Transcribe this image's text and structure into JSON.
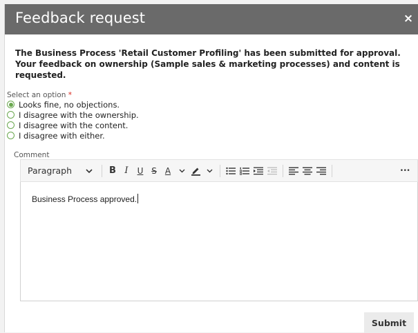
{
  "dialog": {
    "title": "Feedback request",
    "close_glyph": "×",
    "message": "The Business Process 'Retail Customer Profiling' has been submitted for approval. Your feedback on ownership (Sample sales & marketing processes) and content is requested."
  },
  "form": {
    "select_label": "Select an option",
    "required_mark": "*",
    "options": [
      {
        "label": "Looks fine, no objections.",
        "checked": true
      },
      {
        "label": "I disagree with the ownership.",
        "checked": false
      },
      {
        "label": "I disagree with the content.",
        "checked": false
      },
      {
        "label": "I disagree with either.",
        "checked": false
      }
    ],
    "comment_label": "Comment",
    "comment_value": "Business Process approved."
  },
  "toolbar": {
    "paragraph_label": "Paragraph",
    "bold": "B",
    "italic": "I",
    "underline": "U",
    "strike": "S",
    "font_color": "A",
    "more": "•••"
  },
  "actions": {
    "submit_label": "Submit"
  },
  "colors": {
    "header_bg": "#6a6a6a",
    "radio_accent": "#6aa84f",
    "required": "#d9251c"
  }
}
